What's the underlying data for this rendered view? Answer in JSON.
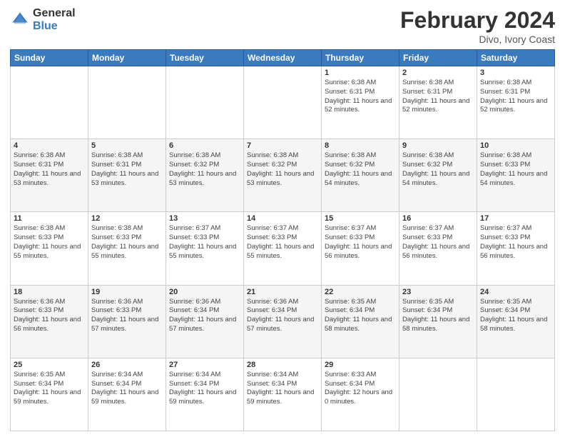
{
  "logo": {
    "general": "General",
    "blue": "Blue"
  },
  "header": {
    "month": "February 2024",
    "location": "Divo, Ivory Coast"
  },
  "weekdays": [
    "Sunday",
    "Monday",
    "Tuesday",
    "Wednesday",
    "Thursday",
    "Friday",
    "Saturday"
  ],
  "weeks": [
    [
      {
        "day": "",
        "info": ""
      },
      {
        "day": "",
        "info": ""
      },
      {
        "day": "",
        "info": ""
      },
      {
        "day": "",
        "info": ""
      },
      {
        "day": "1",
        "info": "Sunrise: 6:38 AM\nSunset: 6:31 PM\nDaylight: 11 hours\nand 52 minutes."
      },
      {
        "day": "2",
        "info": "Sunrise: 6:38 AM\nSunset: 6:31 PM\nDaylight: 11 hours\nand 52 minutes."
      },
      {
        "day": "3",
        "info": "Sunrise: 6:38 AM\nSunset: 6:31 PM\nDaylight: 11 hours\nand 52 minutes."
      }
    ],
    [
      {
        "day": "4",
        "info": "Sunrise: 6:38 AM\nSunset: 6:31 PM\nDaylight: 11 hours\nand 53 minutes."
      },
      {
        "day": "5",
        "info": "Sunrise: 6:38 AM\nSunset: 6:31 PM\nDaylight: 11 hours\nand 53 minutes."
      },
      {
        "day": "6",
        "info": "Sunrise: 6:38 AM\nSunset: 6:32 PM\nDaylight: 11 hours\nand 53 minutes."
      },
      {
        "day": "7",
        "info": "Sunrise: 6:38 AM\nSunset: 6:32 PM\nDaylight: 11 hours\nand 53 minutes."
      },
      {
        "day": "8",
        "info": "Sunrise: 6:38 AM\nSunset: 6:32 PM\nDaylight: 11 hours\nand 54 minutes."
      },
      {
        "day": "9",
        "info": "Sunrise: 6:38 AM\nSunset: 6:32 PM\nDaylight: 11 hours\nand 54 minutes."
      },
      {
        "day": "10",
        "info": "Sunrise: 6:38 AM\nSunset: 6:33 PM\nDaylight: 11 hours\nand 54 minutes."
      }
    ],
    [
      {
        "day": "11",
        "info": "Sunrise: 6:38 AM\nSunset: 6:33 PM\nDaylight: 11 hours\nand 55 minutes."
      },
      {
        "day": "12",
        "info": "Sunrise: 6:38 AM\nSunset: 6:33 PM\nDaylight: 11 hours\nand 55 minutes."
      },
      {
        "day": "13",
        "info": "Sunrise: 6:37 AM\nSunset: 6:33 PM\nDaylight: 11 hours\nand 55 minutes."
      },
      {
        "day": "14",
        "info": "Sunrise: 6:37 AM\nSunset: 6:33 PM\nDaylight: 11 hours\nand 55 minutes."
      },
      {
        "day": "15",
        "info": "Sunrise: 6:37 AM\nSunset: 6:33 PM\nDaylight: 11 hours\nand 56 minutes."
      },
      {
        "day": "16",
        "info": "Sunrise: 6:37 AM\nSunset: 6:33 PM\nDaylight: 11 hours\nand 56 minutes."
      },
      {
        "day": "17",
        "info": "Sunrise: 6:37 AM\nSunset: 6:33 PM\nDaylight: 11 hours\nand 56 minutes."
      }
    ],
    [
      {
        "day": "18",
        "info": "Sunrise: 6:36 AM\nSunset: 6:33 PM\nDaylight: 11 hours\nand 56 minutes."
      },
      {
        "day": "19",
        "info": "Sunrise: 6:36 AM\nSunset: 6:33 PM\nDaylight: 11 hours\nand 57 minutes."
      },
      {
        "day": "20",
        "info": "Sunrise: 6:36 AM\nSunset: 6:34 PM\nDaylight: 11 hours\nand 57 minutes."
      },
      {
        "day": "21",
        "info": "Sunrise: 6:36 AM\nSunset: 6:34 PM\nDaylight: 11 hours\nand 57 minutes."
      },
      {
        "day": "22",
        "info": "Sunrise: 6:35 AM\nSunset: 6:34 PM\nDaylight: 11 hours\nand 58 minutes."
      },
      {
        "day": "23",
        "info": "Sunrise: 6:35 AM\nSunset: 6:34 PM\nDaylight: 11 hours\nand 58 minutes."
      },
      {
        "day": "24",
        "info": "Sunrise: 6:35 AM\nSunset: 6:34 PM\nDaylight: 11 hours\nand 58 minutes."
      }
    ],
    [
      {
        "day": "25",
        "info": "Sunrise: 6:35 AM\nSunset: 6:34 PM\nDaylight: 11 hours\nand 59 minutes."
      },
      {
        "day": "26",
        "info": "Sunrise: 6:34 AM\nSunset: 6:34 PM\nDaylight: 11 hours\nand 59 minutes."
      },
      {
        "day": "27",
        "info": "Sunrise: 6:34 AM\nSunset: 6:34 PM\nDaylight: 11 hours\nand 59 minutes."
      },
      {
        "day": "28",
        "info": "Sunrise: 6:34 AM\nSunset: 6:34 PM\nDaylight: 11 hours\nand 59 minutes."
      },
      {
        "day": "29",
        "info": "Sunrise: 6:33 AM\nSunset: 6:34 PM\nDaylight: 12 hours\nand 0 minutes."
      },
      {
        "day": "",
        "info": ""
      },
      {
        "day": "",
        "info": ""
      }
    ]
  ]
}
